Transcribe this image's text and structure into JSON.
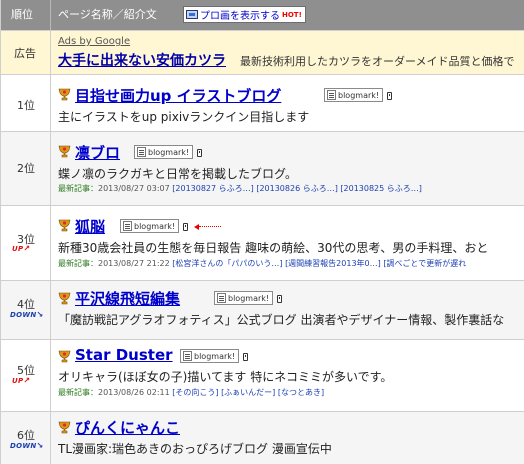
{
  "header": {
    "rank_col": "順位",
    "page_col": "ページ名称／紹介文",
    "promo_button": "プロ画を表示する",
    "promo_hot": "HOT!"
  },
  "ad": {
    "rank_label": "広告",
    "ads_by": "Ads by Google",
    "title": "大手に出来ない安価カツラ",
    "description": "最新技術利用したカツラをオーダーメイド品質と価格で",
    "title_color": "#0000aa"
  },
  "bookmark_label": "blogmark!",
  "latest_label": "最新記事：",
  "entries": [
    {
      "rank": "1位",
      "title": "目指せ画力up イラストブログ",
      "description": "主にイラストをup pixivランクイン目指します"
    },
    {
      "rank": "2位",
      "title": "凛ブロ",
      "description": "蝶ノ凛のラクガキと日常を掲載したブログ。",
      "latest_date": "2013/08/27 03:07",
      "latest_links": [
        "[20130827 らふろ…]",
        "[20130826 らふろ…]",
        "[20130825 らふろ…]"
      ]
    },
    {
      "rank": "3位",
      "change": "UP",
      "title": "狐脳",
      "description": "新種30歳会社員の生態を毎日報告 趣味の萌絵、30代の思考、男の手料理、おと",
      "latest_date": "2013/08/27 21:22",
      "latest_links": [
        "[松宮洋さんの「パパのいう…]",
        "[週間練習報告2013年0…]",
        "[調べごとで更新が遅れ"
      ]
    },
    {
      "rank": "4位",
      "change": "DOWN",
      "title": "平沢線飛短編集",
      "description": "「魔訪戦記アグラオフォティス」公式ブログ 出演者やデザイナー情報、製作裏話な"
    },
    {
      "rank": "5位",
      "change": "UP",
      "title": "Star Duster",
      "description": "オリキャラ(ほぼ女の子)描いてます 特にネコミミが多いです。",
      "latest_date": "2013/08/26 02:11",
      "latest_links": [
        "[その向こう]",
        "[ふぁいんだー]",
        "[なつとあき]"
      ]
    },
    {
      "rank": "6位",
      "change": "DOWN",
      "title": "ぴんくにゃんこ",
      "description": "TL漫画家:瑞色あきのおっぴろげブログ 漫画宣伝中"
    }
  ],
  "colors": {
    "header_bg": "#8f8f8f",
    "ad_bg": "#fff7d3",
    "row_alt_bg": "#f5f5f5",
    "link": "#0000cc",
    "up": "#e01010",
    "down": "#1a3fb0"
  }
}
